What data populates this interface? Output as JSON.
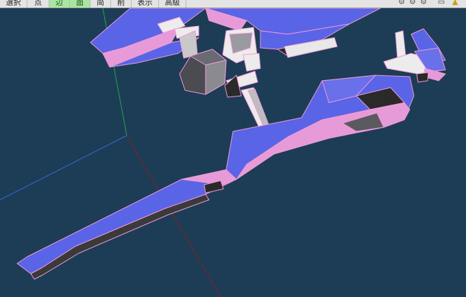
{
  "toolbar": {
    "buttons": [
      {
        "label": "選択",
        "active": false
      },
      {
        "label": "点",
        "active": false
      },
      {
        "label": "辺",
        "active": true
      },
      {
        "label": "面",
        "active": true
      },
      {
        "label": "简",
        "active": false
      },
      {
        "label": "削",
        "active": false
      },
      {
        "label": "表示",
        "active": false
      },
      {
        "label": "高級",
        "active": false
      }
    ],
    "right_icons": [
      "gear-icon",
      "gear-icon",
      "gear-icon",
      "monitor-icon",
      "warning-icon"
    ]
  },
  "viewport": {
    "background": "#1d3d57",
    "axis_colors": {
      "x": "#8b1c1c",
      "y": "#22a84a",
      "z": "#3a66d8"
    },
    "mesh_colors": {
      "face_blue": "#5a64e6",
      "face_pink": "#e69ad8",
      "face_white": "#ececec",
      "face_dark": "#2a2a2a",
      "wire": "#f29ad6"
    }
  }
}
